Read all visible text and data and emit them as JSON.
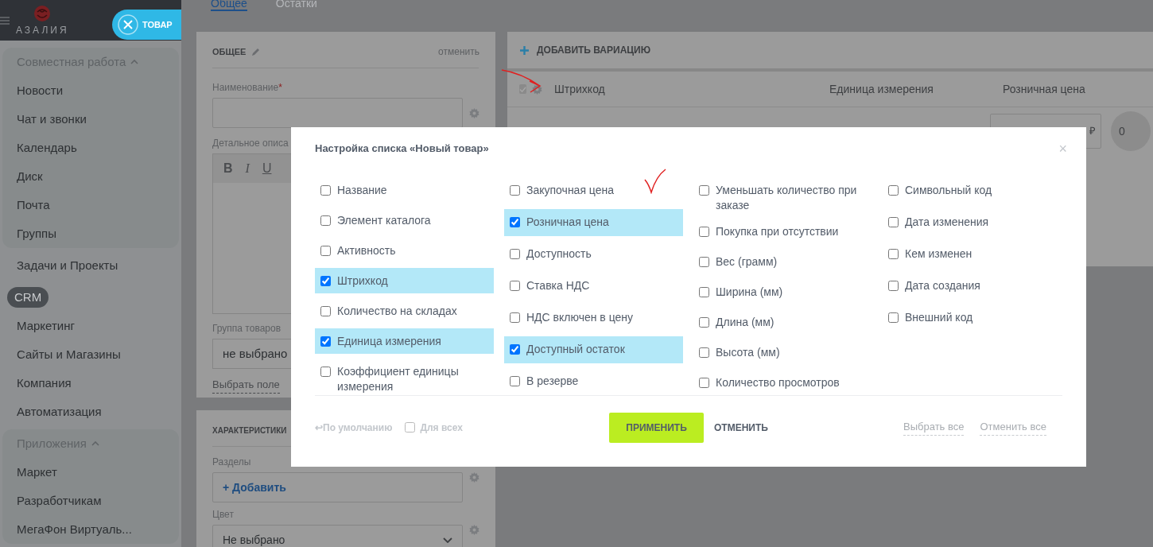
{
  "header": {
    "logo_text": "АЗАЛИЯ",
    "close_button": "ТОВАР"
  },
  "tabs": [
    {
      "label": "Общее",
      "selected": true
    },
    {
      "label": "Остатки",
      "selected": false
    }
  ],
  "sidebar": {
    "groups": [
      {
        "title": "Совместная работа",
        "expanded": true,
        "items": [
          "Новости",
          "Чат и звонки",
          "Календарь",
          "Диск",
          "Почта",
          "Группы"
        ]
      },
      {
        "items": [
          "Задачи и Проекты"
        ]
      },
      {
        "badge": "CRM",
        "items": [
          "Маркетинг",
          "Сайты и Магазины",
          "Компания",
          "Автоматизация"
        ]
      },
      {
        "title": "Приложения",
        "expanded": true,
        "items": [
          "Маркет",
          "Разработчикам",
          "МегаФон Виртуаль..."
        ]
      }
    ]
  },
  "general_card": {
    "title": "ОБЩЕЕ",
    "cancel": "отменить",
    "name_label": "Наименование",
    "required_mark": "*",
    "description_label": "Детальное описа",
    "toolbar": [
      "B",
      "I",
      "U"
    ],
    "group_label": "Группа товаров",
    "group_value": "не выбрано",
    "choose_field": "Выбрать поле"
  },
  "properties_card": {
    "title": "ХАРАКТЕРИСТИКИ",
    "sections_label": "Разделы",
    "add_button": "+ Добавить",
    "color_label": "Цвет",
    "color_value": "Не выбрано"
  },
  "variations": {
    "all_checked": true,
    "add_button": "ДОБАВИТЬ ВАРИАЦИЮ",
    "columns": [
      "Штрихкод",
      "Единица измерения",
      "Розничная цена"
    ],
    "currency": "₽",
    "quantity": "0"
  },
  "modal": {
    "title": "Настройка списка «Новый товар»",
    "close": "×",
    "columns": [
      [
        {
          "label": "Название",
          "checked": false
        },
        {
          "label": "Элемент каталога",
          "checked": false
        },
        {
          "label": "Активность",
          "checked": false
        },
        {
          "label": "Штрихкод",
          "checked": true
        },
        {
          "label": "Количество на складах",
          "checked": false
        },
        {
          "label": "Единица измерения",
          "checked": true
        },
        {
          "label": "Коэффициент единицы измерения",
          "checked": false
        }
      ],
      [
        {
          "label": "Закупочная цена",
          "checked": false
        },
        {
          "label": "Розничная цена",
          "checked": true
        },
        {
          "label": "Доступность",
          "checked": false
        },
        {
          "label": "Ставка НДС",
          "checked": false
        },
        {
          "label": "НДС включен в цену",
          "checked": false
        },
        {
          "label": "Доступный остаток",
          "checked": true
        },
        {
          "label": "В резерве",
          "checked": false
        }
      ],
      [
        {
          "label": "Уменьшать количество при заказе",
          "checked": false
        },
        {
          "label": "Покупка при отсутствии",
          "checked": false
        },
        {
          "label": "Вес (грамм)",
          "checked": false
        },
        {
          "label": "Ширина (мм)",
          "checked": false
        },
        {
          "label": "Длина (мм)",
          "checked": false
        },
        {
          "label": "Высота (мм)",
          "checked": false
        },
        {
          "label": "Количество просмотров",
          "checked": false
        }
      ],
      [
        {
          "label": "Символьный код",
          "checked": false
        },
        {
          "label": "Дата изменения",
          "checked": false
        },
        {
          "label": "Кем изменен",
          "checked": false
        },
        {
          "label": "Дата создания",
          "checked": false
        },
        {
          "label": "Внешний код",
          "checked": false
        }
      ]
    ],
    "default_link": "↩По умолчанию",
    "for_all": {
      "label": "Для всех",
      "checked": false
    },
    "apply": "ПРИМЕНИТЬ",
    "cancel": "ОТМЕНИТЬ",
    "select_all": "Выбрать все",
    "deselect_all": "Отменить все"
  }
}
